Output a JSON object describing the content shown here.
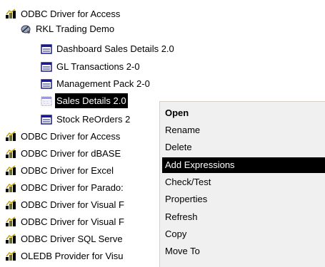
{
  "tree": {
    "items": [
      {
        "label": "ODBC Driver for Access",
        "icon": "driver-icon"
      },
      {
        "label": "RKL Trading Demo",
        "icon": "datasource-icon"
      },
      {
        "label": "Dashboard Sales Details 2.0",
        "icon": "report-icon"
      },
      {
        "label": "GL Transactions 2-0",
        "icon": "report-icon"
      },
      {
        "label": "Management Pack 2-0",
        "icon": "report-icon"
      },
      {
        "label": "Sales Details 2.0",
        "icon": "report-dotted-icon"
      },
      {
        "label": "Stock ReOrders 2",
        "icon": "report-icon"
      },
      {
        "label": "ODBC Driver for Access",
        "icon": "driver-icon"
      },
      {
        "label": "ODBC Driver for dBASE",
        "icon": "driver-icon"
      },
      {
        "label": "ODBC Driver for Excel",
        "icon": "driver-icon"
      },
      {
        "label": "ODBC Driver for Parado:",
        "icon": "driver-icon"
      },
      {
        "label": "ODBC Driver for Visual F",
        "icon": "driver-icon"
      },
      {
        "label": "ODBC Driver for Visual F",
        "icon": "driver-icon"
      },
      {
        "label": "ODBC Driver SQL Serve",
        "icon": "driver-icon"
      },
      {
        "label": "OLEDB Provider for Visu",
        "icon": "driver-icon"
      }
    ]
  },
  "context_menu": {
    "items": [
      "Open",
      "Rename",
      "Delete",
      "Add Expressions",
      "Check/Test",
      "Properties",
      "Refresh",
      "Copy",
      "Move To"
    ],
    "default_item": "Open",
    "highlighted_item": "Add Expressions"
  },
  "colors": {
    "selection": "#000000",
    "menu_background": "#f0f0f0"
  }
}
